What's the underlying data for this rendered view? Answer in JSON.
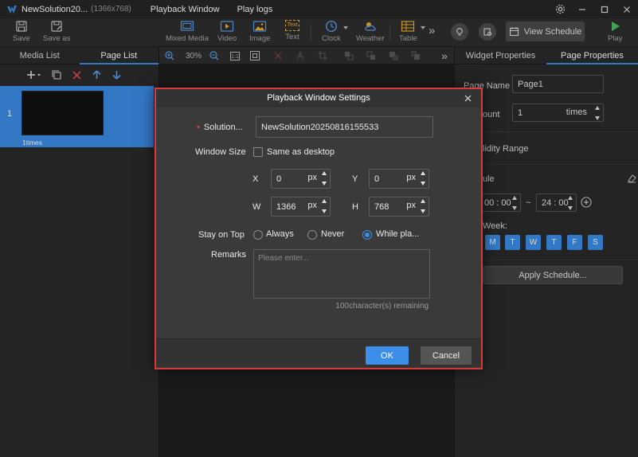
{
  "titlebar": {
    "app_title": "NewSolution20...",
    "resolution": "(1366x768)",
    "menu": [
      "Playback Window",
      "Play logs"
    ]
  },
  "toolbar": {
    "save": "Save",
    "save_as": "Save as",
    "mixed_media": "Mixed Media",
    "video": "Video",
    "image": "Image",
    "text": "Text",
    "text_icon_glyph": "Text",
    "clock": "Clock",
    "weather": "Weather",
    "table": "Table",
    "more": "»",
    "view_schedule": "View Schedule",
    "play": "Play"
  },
  "left_panel": {
    "tabs": [
      "Media List",
      "Page List"
    ],
    "active_tab": "Page List",
    "pages": [
      {
        "number": "1",
        "times": "1times"
      }
    ]
  },
  "canvas_toolbar": {
    "zoom": "30%",
    "more": "»"
  },
  "right_panel": {
    "tabs": [
      "Widget Properties",
      "Page Properties"
    ],
    "active_tab": "Page Properties",
    "page_name_label": "Page Name",
    "page_name_value": "Page1",
    "count_label": "ount",
    "count_value": "1",
    "count_unit": "times",
    "validity_label": "lidity Range",
    "schedule_label": "ule",
    "time_start": "00 : 00",
    "time_sep": "~",
    "time_end": "24 : 00",
    "week_label": "Week:",
    "days": [
      "M",
      "T",
      "W",
      "T",
      "F",
      "S"
    ],
    "apply_schedule": "Apply Schedule..."
  },
  "dialog": {
    "title": "Playback Window Settings",
    "solution_label": "Solution...",
    "solution_value": "NewSolution20250816155533",
    "window_size_label": "Window Size",
    "same_as_desktop": "Same as desktop",
    "same_as_desktop_checked": false,
    "x_label": "X",
    "x_value": "0",
    "y_label": "Y",
    "y_value": "0",
    "w_label": "W",
    "w_value": "1366",
    "h_label": "H",
    "h_value": "768",
    "unit": "px",
    "stay_on_top_label": "Stay on Top",
    "stay_options": [
      "Always",
      "Never",
      "While pla..."
    ],
    "stay_selected": "While pla...",
    "remarks_label": "Remarks",
    "remarks_placeholder": "Please enter...",
    "remaining": "100character(s) remaining",
    "ok": "OK",
    "cancel": "Cancel"
  },
  "colors": {
    "accent": "#3d8ee8",
    "highlight_border": "#d93a3a"
  }
}
